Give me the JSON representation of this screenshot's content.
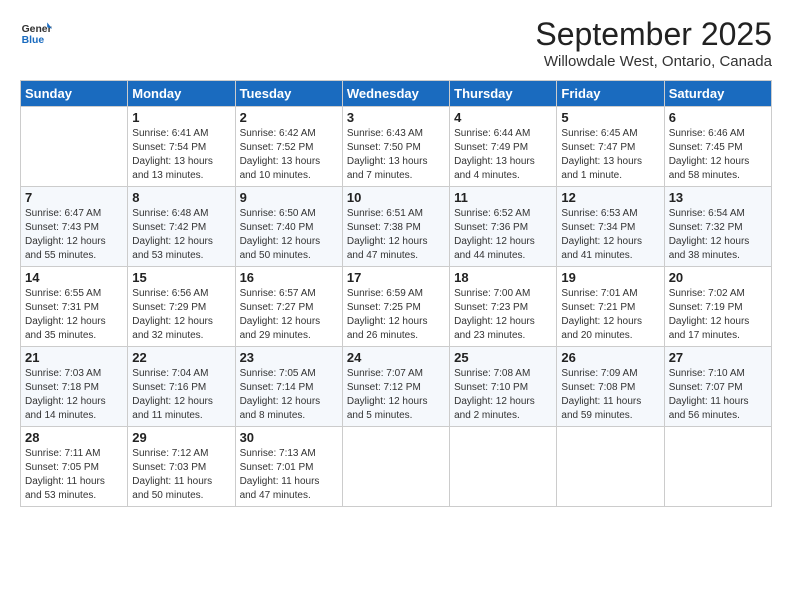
{
  "header": {
    "logo_general": "General",
    "logo_blue": "Blue",
    "title": "September 2025",
    "subtitle": "Willowdale West, Ontario, Canada"
  },
  "days_of_week": [
    "Sunday",
    "Monday",
    "Tuesday",
    "Wednesday",
    "Thursday",
    "Friday",
    "Saturday"
  ],
  "weeks": [
    [
      {
        "day": "",
        "text": ""
      },
      {
        "day": "1",
        "text": "Sunrise: 6:41 AM\nSunset: 7:54 PM\nDaylight: 13 hours\nand 13 minutes."
      },
      {
        "day": "2",
        "text": "Sunrise: 6:42 AM\nSunset: 7:52 PM\nDaylight: 13 hours\nand 10 minutes."
      },
      {
        "day": "3",
        "text": "Sunrise: 6:43 AM\nSunset: 7:50 PM\nDaylight: 13 hours\nand 7 minutes."
      },
      {
        "day": "4",
        "text": "Sunrise: 6:44 AM\nSunset: 7:49 PM\nDaylight: 13 hours\nand 4 minutes."
      },
      {
        "day": "5",
        "text": "Sunrise: 6:45 AM\nSunset: 7:47 PM\nDaylight: 13 hours\nand 1 minute."
      },
      {
        "day": "6",
        "text": "Sunrise: 6:46 AM\nSunset: 7:45 PM\nDaylight: 12 hours\nand 58 minutes."
      }
    ],
    [
      {
        "day": "7",
        "text": "Sunrise: 6:47 AM\nSunset: 7:43 PM\nDaylight: 12 hours\nand 55 minutes."
      },
      {
        "day": "8",
        "text": "Sunrise: 6:48 AM\nSunset: 7:42 PM\nDaylight: 12 hours\nand 53 minutes."
      },
      {
        "day": "9",
        "text": "Sunrise: 6:50 AM\nSunset: 7:40 PM\nDaylight: 12 hours\nand 50 minutes."
      },
      {
        "day": "10",
        "text": "Sunrise: 6:51 AM\nSunset: 7:38 PM\nDaylight: 12 hours\nand 47 minutes."
      },
      {
        "day": "11",
        "text": "Sunrise: 6:52 AM\nSunset: 7:36 PM\nDaylight: 12 hours\nand 44 minutes."
      },
      {
        "day": "12",
        "text": "Sunrise: 6:53 AM\nSunset: 7:34 PM\nDaylight: 12 hours\nand 41 minutes."
      },
      {
        "day": "13",
        "text": "Sunrise: 6:54 AM\nSunset: 7:32 PM\nDaylight: 12 hours\nand 38 minutes."
      }
    ],
    [
      {
        "day": "14",
        "text": "Sunrise: 6:55 AM\nSunset: 7:31 PM\nDaylight: 12 hours\nand 35 minutes."
      },
      {
        "day": "15",
        "text": "Sunrise: 6:56 AM\nSunset: 7:29 PM\nDaylight: 12 hours\nand 32 minutes."
      },
      {
        "day": "16",
        "text": "Sunrise: 6:57 AM\nSunset: 7:27 PM\nDaylight: 12 hours\nand 29 minutes."
      },
      {
        "day": "17",
        "text": "Sunrise: 6:59 AM\nSunset: 7:25 PM\nDaylight: 12 hours\nand 26 minutes."
      },
      {
        "day": "18",
        "text": "Sunrise: 7:00 AM\nSunset: 7:23 PM\nDaylight: 12 hours\nand 23 minutes."
      },
      {
        "day": "19",
        "text": "Sunrise: 7:01 AM\nSunset: 7:21 PM\nDaylight: 12 hours\nand 20 minutes."
      },
      {
        "day": "20",
        "text": "Sunrise: 7:02 AM\nSunset: 7:19 PM\nDaylight: 12 hours\nand 17 minutes."
      }
    ],
    [
      {
        "day": "21",
        "text": "Sunrise: 7:03 AM\nSunset: 7:18 PM\nDaylight: 12 hours\nand 14 minutes."
      },
      {
        "day": "22",
        "text": "Sunrise: 7:04 AM\nSunset: 7:16 PM\nDaylight: 12 hours\nand 11 minutes."
      },
      {
        "day": "23",
        "text": "Sunrise: 7:05 AM\nSunset: 7:14 PM\nDaylight: 12 hours\nand 8 minutes."
      },
      {
        "day": "24",
        "text": "Sunrise: 7:07 AM\nSunset: 7:12 PM\nDaylight: 12 hours\nand 5 minutes."
      },
      {
        "day": "25",
        "text": "Sunrise: 7:08 AM\nSunset: 7:10 PM\nDaylight: 12 hours\nand 2 minutes."
      },
      {
        "day": "26",
        "text": "Sunrise: 7:09 AM\nSunset: 7:08 PM\nDaylight: 11 hours\nand 59 minutes."
      },
      {
        "day": "27",
        "text": "Sunrise: 7:10 AM\nSunset: 7:07 PM\nDaylight: 11 hours\nand 56 minutes."
      }
    ],
    [
      {
        "day": "28",
        "text": "Sunrise: 7:11 AM\nSunset: 7:05 PM\nDaylight: 11 hours\nand 53 minutes."
      },
      {
        "day": "29",
        "text": "Sunrise: 7:12 AM\nSunset: 7:03 PM\nDaylight: 11 hours\nand 50 minutes."
      },
      {
        "day": "30",
        "text": "Sunrise: 7:13 AM\nSunset: 7:01 PM\nDaylight: 11 hours\nand 47 minutes."
      },
      {
        "day": "",
        "text": ""
      },
      {
        "day": "",
        "text": ""
      },
      {
        "day": "",
        "text": ""
      },
      {
        "day": "",
        "text": ""
      }
    ]
  ]
}
